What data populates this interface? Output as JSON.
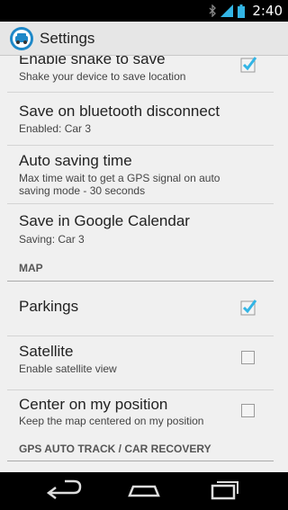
{
  "status_bar": {
    "time": "2:40",
    "icons": [
      "bluetooth-icon",
      "signal-icon",
      "battery-icon"
    ]
  },
  "action_bar": {
    "title": "Settings",
    "icon": "car-app-icon"
  },
  "prefs": [
    {
      "title": "Enable shake to save",
      "summary": "Shake your device to save location",
      "checkbox": true,
      "checked": true
    },
    {
      "title": "Save on bluetooth disconnect",
      "summary": "Enabled: Car 3"
    },
    {
      "title": "Auto saving time",
      "summary_lines": [
        "Max time wait to get a GPS signal on auto",
        "saving mode - 30 seconds"
      ]
    },
    {
      "title": "Save in Google Calendar",
      "summary": "Saving: Car 3"
    }
  ],
  "categories": [
    {
      "title": "MAP"
    },
    {
      "title": "GPS AUTO TRACK / CAR RECOVERY"
    }
  ],
  "map_prefs": [
    {
      "title": "Parkings",
      "checkbox": true,
      "checked": true
    },
    {
      "title": "Satellite",
      "summary": "Enable satellite view",
      "checkbox": true,
      "checked": false
    },
    {
      "title": "Center on my position",
      "summary": "Keep the map centered on my position",
      "checkbox": true,
      "checked": false
    }
  ],
  "nav_bar": {
    "buttons": [
      "back-icon",
      "home-icon",
      "recent-apps-icon"
    ]
  },
  "colors": {
    "accent": "#33b5e5",
    "background": "#f0f0f0",
    "action_bar": "#e6e6e6"
  }
}
